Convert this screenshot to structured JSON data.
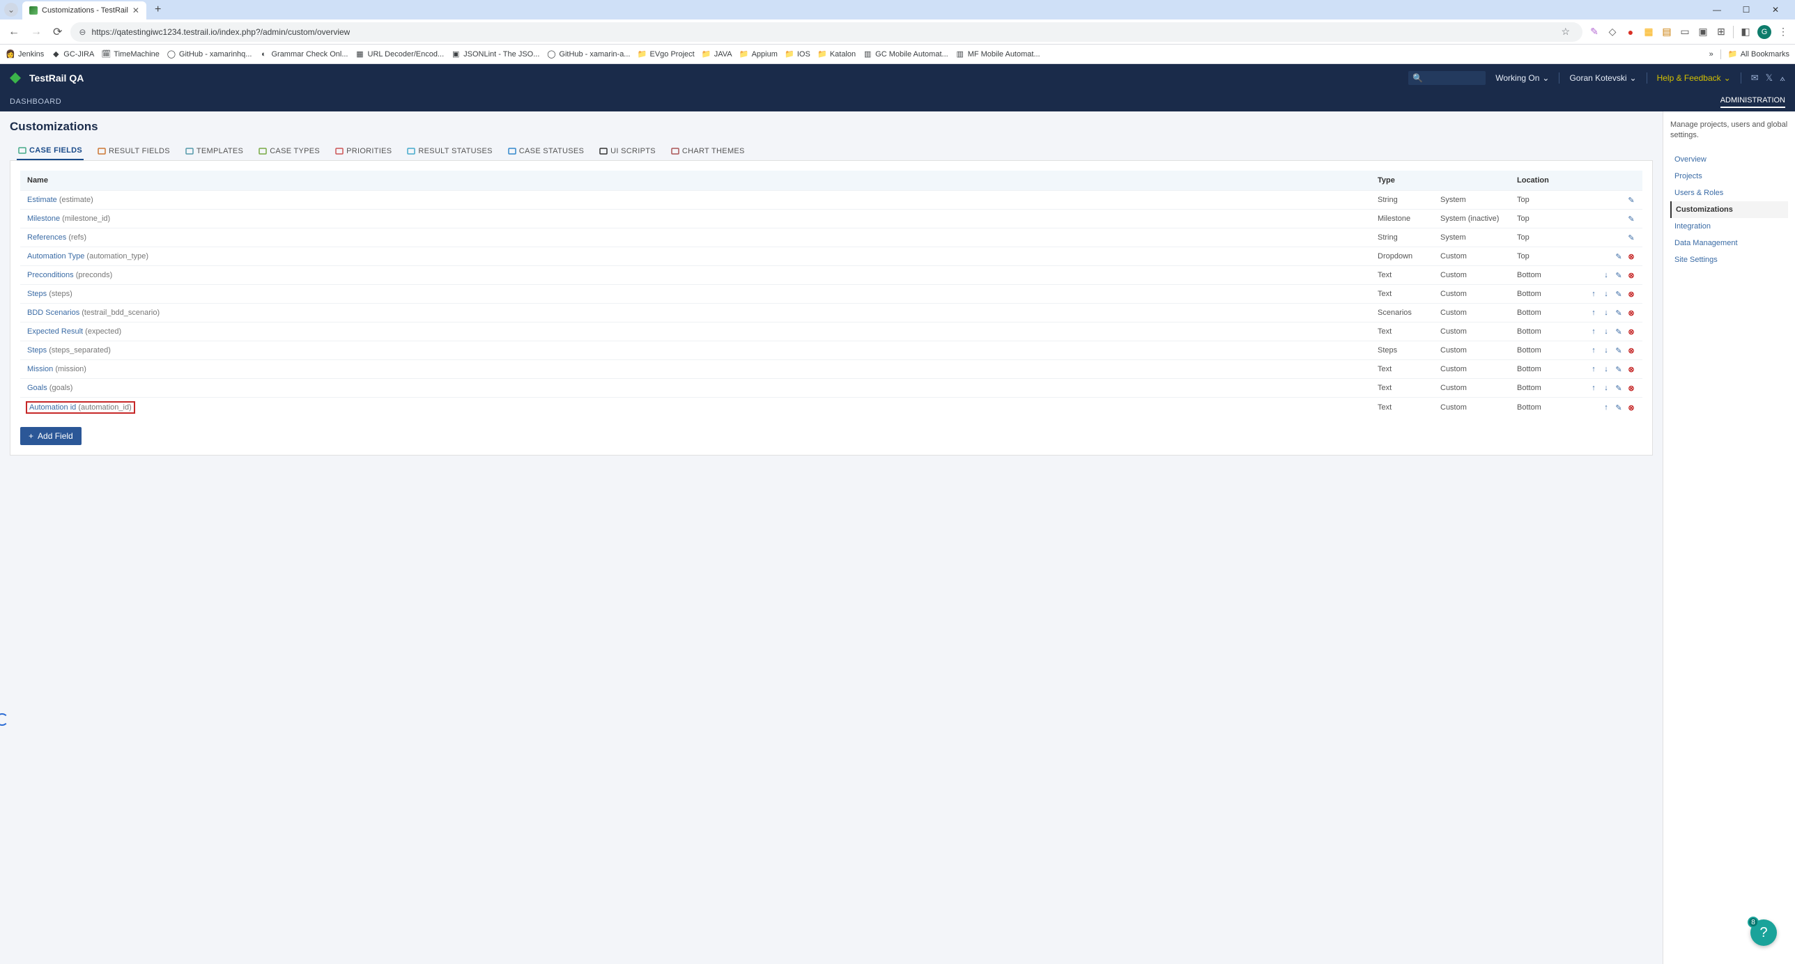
{
  "browser": {
    "tab_title": "Customizations - TestRail",
    "url": "https://qatestingiwc1234.testrail.io/index.php?/admin/custom/overview",
    "window_controls": {
      "min": "—",
      "max": "☐",
      "close": "✕"
    },
    "bookmarks": [
      {
        "label": "Jenkins",
        "icon": "👩"
      },
      {
        "label": "GC-JIRA",
        "icon": "◆"
      },
      {
        "label": "TimeMachine",
        "icon": "🗓"
      },
      {
        "label": "GitHub - xamarinhq...",
        "icon": "◯"
      },
      {
        "label": "Grammar Check Onl...",
        "icon": "◐"
      },
      {
        "label": "URL Decoder/Encod...",
        "icon": "▦"
      },
      {
        "label": "JSONLint - The JSO...",
        "icon": "▣"
      },
      {
        "label": "GitHub - xamarin-a...",
        "icon": "◯"
      },
      {
        "label": "EVgo Project",
        "icon": "folder"
      },
      {
        "label": "JAVA",
        "icon": "folder"
      },
      {
        "label": "Appium",
        "icon": "folder"
      },
      {
        "label": "IOS",
        "icon": "folder"
      },
      {
        "label": "Katalon",
        "icon": "folder"
      },
      {
        "label": "GC Mobile Automat...",
        "icon": "▥"
      },
      {
        "label": "MF Mobile Automat...",
        "icon": "▥"
      }
    ],
    "all_bookmarks": "All Bookmarks",
    "overflow": "»",
    "avatar_letter": "G"
  },
  "header": {
    "app": "TestRail QA",
    "working_on": "Working On",
    "user": "Goran Kotevski",
    "help": "Help & Feedback"
  },
  "subnav": {
    "left": "DASHBOARD",
    "right_active": "ADMINISTRATION"
  },
  "page": {
    "title": "Customizations"
  },
  "tabs": [
    {
      "label": "CASE FIELDS"
    },
    {
      "label": "RESULT FIELDS"
    },
    {
      "label": "TEMPLATES"
    },
    {
      "label": "CASE TYPES"
    },
    {
      "label": "PRIORITIES"
    },
    {
      "label": "RESULT STATUSES"
    },
    {
      "label": "CASE STATUSES"
    },
    {
      "label": "UI SCRIPTS"
    },
    {
      "label": "CHART THEMES"
    }
  ],
  "table": {
    "headers": {
      "name": "Name",
      "type": "Type",
      "location": "Location"
    },
    "rows": [
      {
        "name": "Estimate",
        "slug": " (estimate)",
        "type": "String",
        "sys": "System",
        "loc": "Top",
        "actions": [
          "edit"
        ]
      },
      {
        "name": "Milestone",
        "slug": " (milestone_id)",
        "type": "Milestone",
        "sys": "System (inactive)",
        "loc": "Top",
        "actions": [
          "edit"
        ]
      },
      {
        "name": "References",
        "slug": " (refs)",
        "type": "String",
        "sys": "System",
        "loc": "Top",
        "actions": [
          "edit"
        ]
      },
      {
        "name": "Automation Type",
        "slug": " (automation_type)",
        "type": "Dropdown",
        "sys": "Custom",
        "loc": "Top",
        "actions": [
          "edit",
          "del"
        ]
      },
      {
        "name": "Preconditions",
        "slug": " (preconds)",
        "type": "Text",
        "sys": "Custom",
        "loc": "Bottom",
        "actions": [
          "down",
          "edit",
          "del"
        ]
      },
      {
        "name": "Steps",
        "slug": " (steps)",
        "type": "Text",
        "sys": "Custom",
        "loc": "Bottom",
        "actions": [
          "up",
          "down",
          "edit",
          "del"
        ]
      },
      {
        "name": "BDD Scenarios",
        "slug": " (testrail_bdd_scenario)",
        "type": "Scenarios",
        "sys": "Custom",
        "loc": "Bottom",
        "actions": [
          "up",
          "down",
          "edit",
          "del"
        ]
      },
      {
        "name": "Expected Result",
        "slug": " (expected)",
        "type": "Text",
        "sys": "Custom",
        "loc": "Bottom",
        "actions": [
          "up",
          "down",
          "edit",
          "del"
        ]
      },
      {
        "name": "Steps",
        "slug": " (steps_separated)",
        "type": "Steps",
        "sys": "Custom",
        "loc": "Bottom",
        "actions": [
          "up",
          "down",
          "edit",
          "del"
        ]
      },
      {
        "name": "Mission",
        "slug": " (mission)",
        "type": "Text",
        "sys": "Custom",
        "loc": "Bottom",
        "actions": [
          "up",
          "down",
          "edit",
          "del"
        ]
      },
      {
        "name": "Goals",
        "slug": " (goals)",
        "type": "Text",
        "sys": "Custom",
        "loc": "Bottom",
        "actions": [
          "up",
          "down",
          "edit",
          "del"
        ]
      },
      {
        "name": "Automation id",
        "slug": " (automation_id)",
        "type": "Text",
        "sys": "Custom",
        "loc": "Bottom",
        "actions": [
          "up",
          "edit",
          "del"
        ],
        "highlight": true
      }
    ],
    "add_btn": "Add Field"
  },
  "sidebar": {
    "desc": "Manage projects, users and global settings.",
    "links": [
      {
        "label": "Overview"
      },
      {
        "label": "Projects"
      },
      {
        "label": "Users & Roles"
      },
      {
        "label": "Customizations",
        "active": true
      },
      {
        "label": "Integration"
      },
      {
        "label": "Data Management"
      },
      {
        "label": "Site Settings"
      }
    ]
  },
  "help_bubble": {
    "count": "8",
    "q": "?"
  }
}
